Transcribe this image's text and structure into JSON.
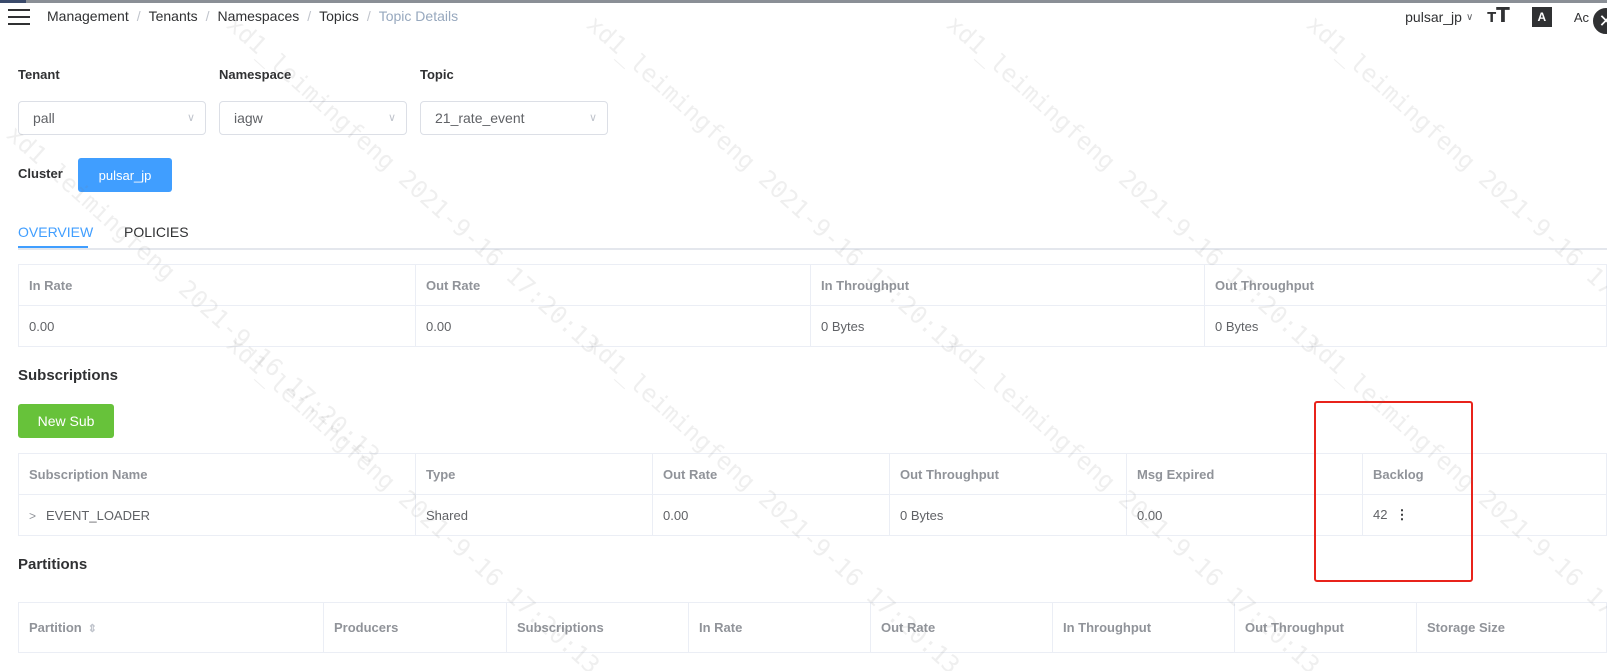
{
  "breadcrumb": [
    "Management",
    "Tenants",
    "Namespaces",
    "Topics",
    "Topic Details"
  ],
  "header": {
    "cluster": "pulsar_jp",
    "text_size_icon": "text-size-icon",
    "language_icon": "A",
    "admin_label": "Ac",
    "close_icon": "✕"
  },
  "form": {
    "tenant_label": "Tenant",
    "tenant_value": "pall",
    "namespace_label": "Namespace",
    "namespace_value": "iagw",
    "topic_label": "Topic",
    "topic_value": "21_rate_event",
    "cluster_label": "Cluster",
    "cluster_button": "pulsar_jp"
  },
  "tabs": [
    {
      "label": "OVERVIEW",
      "active": true
    },
    {
      "label": "POLICIES",
      "active": false
    }
  ],
  "overview": {
    "headers": [
      "In Rate",
      "Out Rate",
      "In Throughput",
      "Out Throughput"
    ],
    "row": [
      "0.00",
      "0.00",
      "0 Bytes",
      "0 Bytes"
    ]
  },
  "subscriptions": {
    "title": "Subscriptions",
    "new_button": "New Sub",
    "headers": [
      "Subscription Name",
      "Type",
      "Out Rate",
      "Out Throughput",
      "Msg Expired",
      "Backlog"
    ],
    "rows": [
      {
        "name": "EVENT_LOADER",
        "type": "Shared",
        "out_rate": "0.00",
        "out_throughput": "0 Bytes",
        "msg_expired": "0.00",
        "backlog": "42"
      }
    ]
  },
  "partitions": {
    "title": "Partitions",
    "headers": [
      "Partition",
      "Producers",
      "Subscriptions",
      "In Rate",
      "Out Rate",
      "In Throughput",
      "Out Throughput",
      "Storage Size"
    ]
  },
  "watermark": "xd1_leimingfeng 2021-9-16 17:20:13",
  "colors": {
    "primary": "#409eff",
    "success": "#67c23a",
    "highlight": "#e8231b"
  }
}
